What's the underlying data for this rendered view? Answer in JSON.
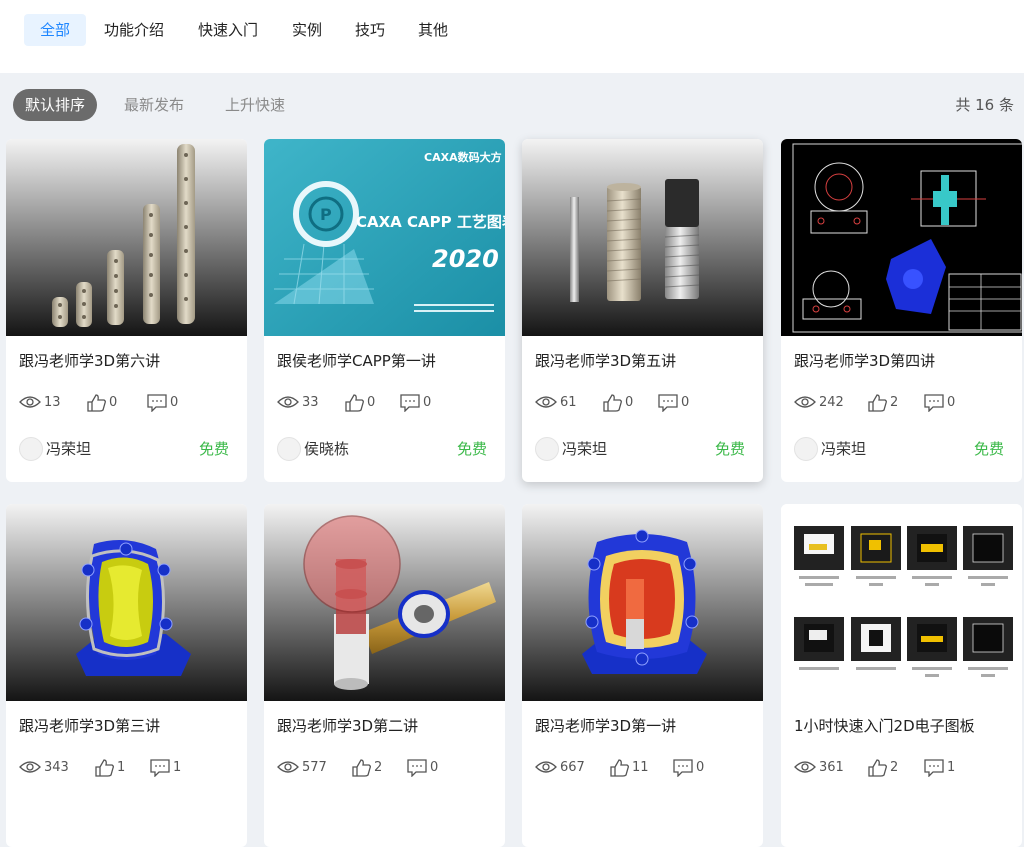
{
  "categories": [
    "全部",
    "功能介绍",
    "快速入门",
    "实例",
    "技巧",
    "其他"
  ],
  "active_category": "全部",
  "sort": {
    "options": [
      "默认排序",
      "最新发布",
      "上升快速"
    ],
    "active": "默认排序"
  },
  "total_text": "共 16 条",
  "colors": {
    "accent": "#1e86ff",
    "price": "#3cb94a",
    "sort_active_bg": "#6b6b6b"
  },
  "cards": [
    {
      "title": "跟冯老师学3D第六讲",
      "views": "13",
      "likes": "0",
      "comments": "0",
      "author": "冯荣坦",
      "price": "免费",
      "thumb": "plates"
    },
    {
      "title": "跟侯老师学CAPP第一讲",
      "views": "33",
      "likes": "0",
      "comments": "0",
      "author": "侯晓栋",
      "price": "免费",
      "thumb": "capp",
      "thumb_text": {
        "brand": "CAXA数码大方",
        "product": "CAXA CAPP 工艺图表",
        "year": "2020"
      }
    },
    {
      "title": "跟冯老师学3D第五讲",
      "views": "61",
      "likes": "0",
      "comments": "0",
      "author": "冯荣坦",
      "price": "免费",
      "thumb": "screws"
    },
    {
      "title": "跟冯老师学3D第四讲",
      "views": "242",
      "likes": "2",
      "comments": "0",
      "author": "冯荣坦",
      "price": "免费",
      "thumb": "drawing"
    },
    {
      "title": "跟冯老师学3D第三讲",
      "views": "343",
      "likes": "1",
      "comments": "1",
      "thumb": "housing-yellow"
    },
    {
      "title": "跟冯老师学3D第二讲",
      "views": "577",
      "likes": "2",
      "comments": "0",
      "thumb": "valve"
    },
    {
      "title": "跟冯老师学3D第一讲",
      "views": "667",
      "likes": "11",
      "comments": "0",
      "thumb": "housing-red"
    },
    {
      "title": "1小时快速入门2D电子图板",
      "views": "361",
      "likes": "2",
      "comments": "1",
      "thumb": "video-grid"
    }
  ],
  "icons": {
    "views": "eye-icon",
    "likes": "thumbs-up-icon",
    "comments": "comment-icon"
  }
}
